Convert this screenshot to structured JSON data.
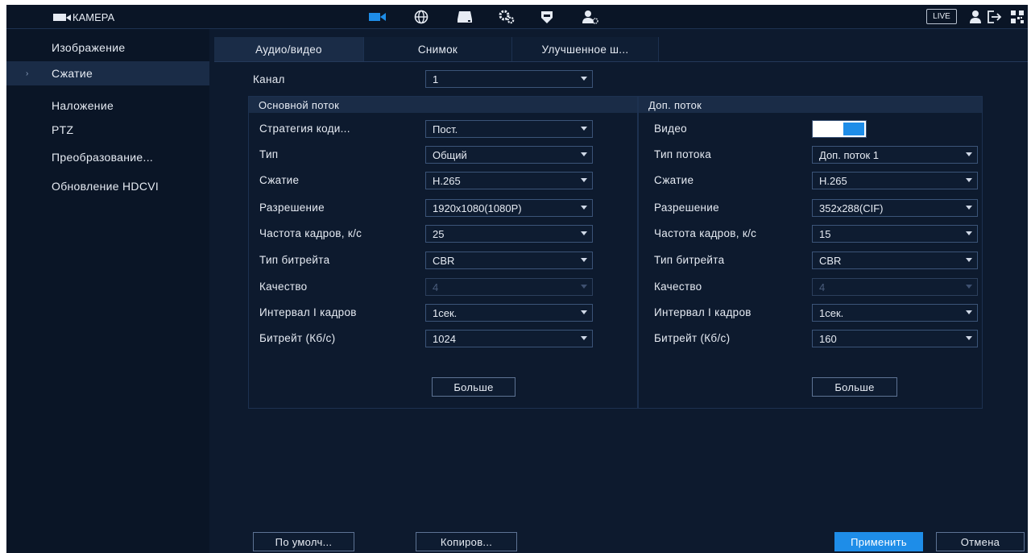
{
  "topbar": {
    "title": "КАМЕРА",
    "icons": [
      "camera-icon",
      "network-icon",
      "storage-icon",
      "system-icon",
      "security-icon",
      "account-icon"
    ],
    "live_label": "LIVE"
  },
  "sidebar": {
    "items": [
      {
        "label": "Изображение"
      },
      {
        "label": "Сжатие",
        "active": true
      },
      {
        "label": "Наложение"
      },
      {
        "label": "PTZ"
      },
      {
        "label": "Преобразование..."
      },
      {
        "label": "Обновление HDCVI"
      }
    ]
  },
  "tabs": [
    {
      "label": "Аудио/видео",
      "active": true
    },
    {
      "label": "Снимок"
    },
    {
      "label": "Улучшенное ш..."
    }
  ],
  "channel": {
    "label": "Канал",
    "value": "1"
  },
  "main_stream": {
    "header": "Основной поток",
    "rows": [
      {
        "label": "Стратегия коди...",
        "value": "Пост."
      },
      {
        "label": "Тип",
        "value": "Общий"
      },
      {
        "label": "Сжатие",
        "value": "H.265"
      },
      {
        "label": "Разрешение",
        "value": "1920x1080(1080P)"
      },
      {
        "label": "Частота кадров, к/с",
        "value": "25"
      },
      {
        "label": "Тип битрейта",
        "value": "CBR"
      },
      {
        "label": "Качество",
        "value": "4"
      },
      {
        "label": "Интервал I кадров",
        "value": "1сек."
      },
      {
        "label": "Битрейт (Кб/с)",
        "value": "1024"
      }
    ],
    "more_label": "Больше"
  },
  "sub_stream": {
    "header": "Доп. поток",
    "video_label": "Видео",
    "video_enabled": true,
    "rows": [
      {
        "label": "Тип потока",
        "value": "Доп. поток 1"
      },
      {
        "label": "Сжатие",
        "value": "H.265"
      },
      {
        "label": "Разрешение",
        "value": "352x288(CIF)"
      },
      {
        "label": "Частота кадров, к/с",
        "value": "15"
      },
      {
        "label": "Тип битрейта",
        "value": "CBR"
      },
      {
        "label": "Качество",
        "value": "4"
      },
      {
        "label": "Интервал I кадров",
        "value": "1сек."
      },
      {
        "label": "Битрейт (Кб/с)",
        "value": "160"
      }
    ],
    "more_label": "Больше"
  },
  "footer": {
    "default_label": "По умолч...",
    "copy_label": "Копиров...",
    "apply_label": "Применить",
    "cancel_label": "Отмена"
  },
  "colors": {
    "background": "#0d1a2e",
    "accent": "#1e8de8",
    "panel_header": "#1a2c47"
  }
}
